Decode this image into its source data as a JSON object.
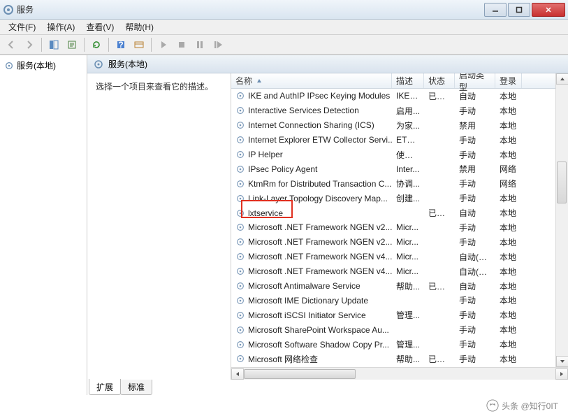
{
  "window": {
    "title": "服务"
  },
  "menu": {
    "file": "文件(F)",
    "action": "操作(A)",
    "view": "查看(V)",
    "help": "帮助(H)"
  },
  "tree": {
    "root": "服务(本地)"
  },
  "content": {
    "header": "服务(本地)",
    "detail_hint": "选择一个项目来查看它的描述。"
  },
  "columns": {
    "name": "名称",
    "desc": "描述",
    "state": "状态",
    "start": "启动类型",
    "logon": "登录"
  },
  "services": [
    {
      "name": "IKE and AuthIP IPsec Keying Modules",
      "desc": "IKEE...",
      "state": "已启动",
      "start": "自动",
      "logon": "本地"
    },
    {
      "name": "Interactive Services Detection",
      "desc": "启用...",
      "state": "",
      "start": "手动",
      "logon": "本地"
    },
    {
      "name": "Internet Connection Sharing (ICS)",
      "desc": "为家...",
      "state": "",
      "start": "禁用",
      "logon": "本地"
    },
    {
      "name": "Internet Explorer ETW Collector Servi...",
      "desc": "ETW...",
      "state": "",
      "start": "手动",
      "logon": "本地"
    },
    {
      "name": "IP Helper",
      "desc": "使用 ...",
      "state": "",
      "start": "手动",
      "logon": "本地"
    },
    {
      "name": "IPsec Policy Agent",
      "desc": "Inter...",
      "state": "",
      "start": "禁用",
      "logon": "网络"
    },
    {
      "name": "KtmRm for Distributed Transaction C...",
      "desc": "协调...",
      "state": "",
      "start": "手动",
      "logon": "网络"
    },
    {
      "name": "Link-Layer Topology Discovery Map...",
      "desc": "创建...",
      "state": "",
      "start": "手动",
      "logon": "本地"
    },
    {
      "name": "lxtservice",
      "desc": "",
      "state": "已启动",
      "start": "自动",
      "logon": "本地",
      "highlight": true
    },
    {
      "name": "Microsoft .NET Framework NGEN v2...",
      "desc": "Micr...",
      "state": "",
      "start": "手动",
      "logon": "本地"
    },
    {
      "name": "Microsoft .NET Framework NGEN v2...",
      "desc": "Micr...",
      "state": "",
      "start": "手动",
      "logon": "本地"
    },
    {
      "name": "Microsoft .NET Framework NGEN v4...",
      "desc": "Micr...",
      "state": "",
      "start": "自动(延迟...",
      "logon": "本地"
    },
    {
      "name": "Microsoft .NET Framework NGEN v4...",
      "desc": "Micr...",
      "state": "",
      "start": "自动(延迟...",
      "logon": "本地"
    },
    {
      "name": "Microsoft Antimalware Service",
      "desc": "帮助...",
      "state": "已启动",
      "start": "自动",
      "logon": "本地"
    },
    {
      "name": "Microsoft IME Dictionary Update",
      "desc": "",
      "state": "",
      "start": "手动",
      "logon": "本地"
    },
    {
      "name": "Microsoft iSCSI Initiator Service",
      "desc": "管理...",
      "state": "",
      "start": "手动",
      "logon": "本地"
    },
    {
      "name": "Microsoft SharePoint Workspace Au...",
      "desc": "",
      "state": "",
      "start": "手动",
      "logon": "本地"
    },
    {
      "name": "Microsoft Software Shadow Copy Pr...",
      "desc": "管理...",
      "state": "",
      "start": "手动",
      "logon": "本地"
    },
    {
      "name": "Microsoft 网络检查",
      "desc": "帮助...",
      "state": "已启动",
      "start": "手动",
      "logon": "本地"
    }
  ],
  "tabs": {
    "extended": "扩展",
    "standard": "标准"
  },
  "watermark": "头条 @知行0IT"
}
